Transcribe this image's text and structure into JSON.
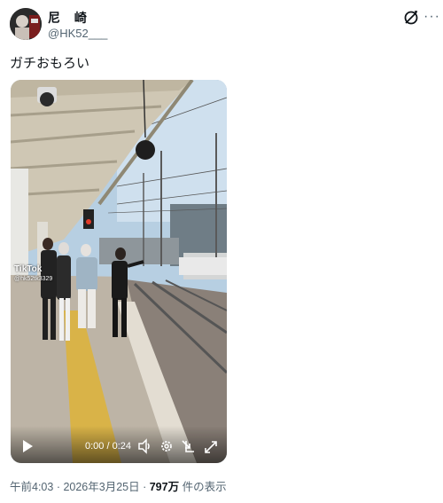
{
  "user": {
    "display_name": "尼 崎",
    "handle": "@HK52___"
  },
  "tweet": {
    "text": "ガチおもろい"
  },
  "video": {
    "watermark_logo": "TikTok",
    "watermark_user": "@hk52tk3329",
    "current_time": "0:00",
    "duration": "0:24",
    "separator": "/"
  },
  "meta": {
    "time": "午前4:03",
    "dot1": " · ",
    "date": "2026年3月25日",
    "dot2": " · ",
    "views": "797万",
    "views_suffix": " 件の表示"
  },
  "icons": {
    "grok": "grok-icon",
    "more": "more-dots-icon",
    "play": "play-icon",
    "volume": "volume-icon",
    "settings": "gear-icon",
    "pip": "picture-in-picture-icon",
    "fullscreen": "fullscreen-icon"
  },
  "colors": {
    "text_primary": "#0f1419",
    "text_secondary": "#536471",
    "tactile_paving": "#d9b348"
  }
}
